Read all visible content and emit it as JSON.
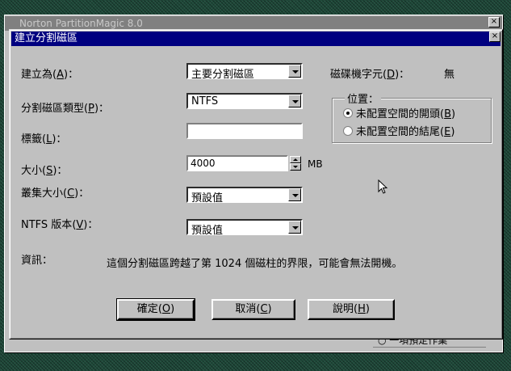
{
  "background_window": {
    "title": "Norton PartitionMagic 8.0",
    "fragment_text": "○ 一項預定作業"
  },
  "dialog": {
    "title": "建立分割磁區",
    "close_glyph": "×",
    "create_as": {
      "label": "建立為",
      "key": "A",
      "value": "主要分割磁區"
    },
    "partition_type": {
      "label": "分割磁區類型",
      "key": "P",
      "value": "NTFS"
    },
    "label_field": {
      "label": "標籤",
      "key": "L",
      "value": ""
    },
    "size": {
      "label": "大小",
      "key": "S",
      "value": "4000",
      "unit": "MB"
    },
    "cluster_size": {
      "label": "叢集大小",
      "key": "C",
      "value": "預設值"
    },
    "ntfs_version": {
      "label": "NTFS 版本",
      "key": "V",
      "value": "預設值"
    },
    "drive_letter": {
      "label": "磁碟機字元",
      "key": "D",
      "value": "無"
    },
    "position": {
      "title": "位置：",
      "options": [
        {
          "label": "未配置空間的開頭",
          "key": "B",
          "checked": true
        },
        {
          "label": "未配置空間的結尾",
          "key": "E",
          "checked": false
        }
      ]
    },
    "info": {
      "label": "資訊：",
      "text": "這個分割磁區跨越了第 1024 個磁柱的界限，可能會無法開機。"
    },
    "buttons": {
      "ok": {
        "label": "確定",
        "key": "O"
      },
      "cancel": {
        "label": "取消",
        "key": "C"
      },
      "help": {
        "label": "說明",
        "key": "H"
      }
    }
  },
  "colors": {
    "titlebar": "#000080",
    "dialog_face": "#c0c0c0"
  }
}
